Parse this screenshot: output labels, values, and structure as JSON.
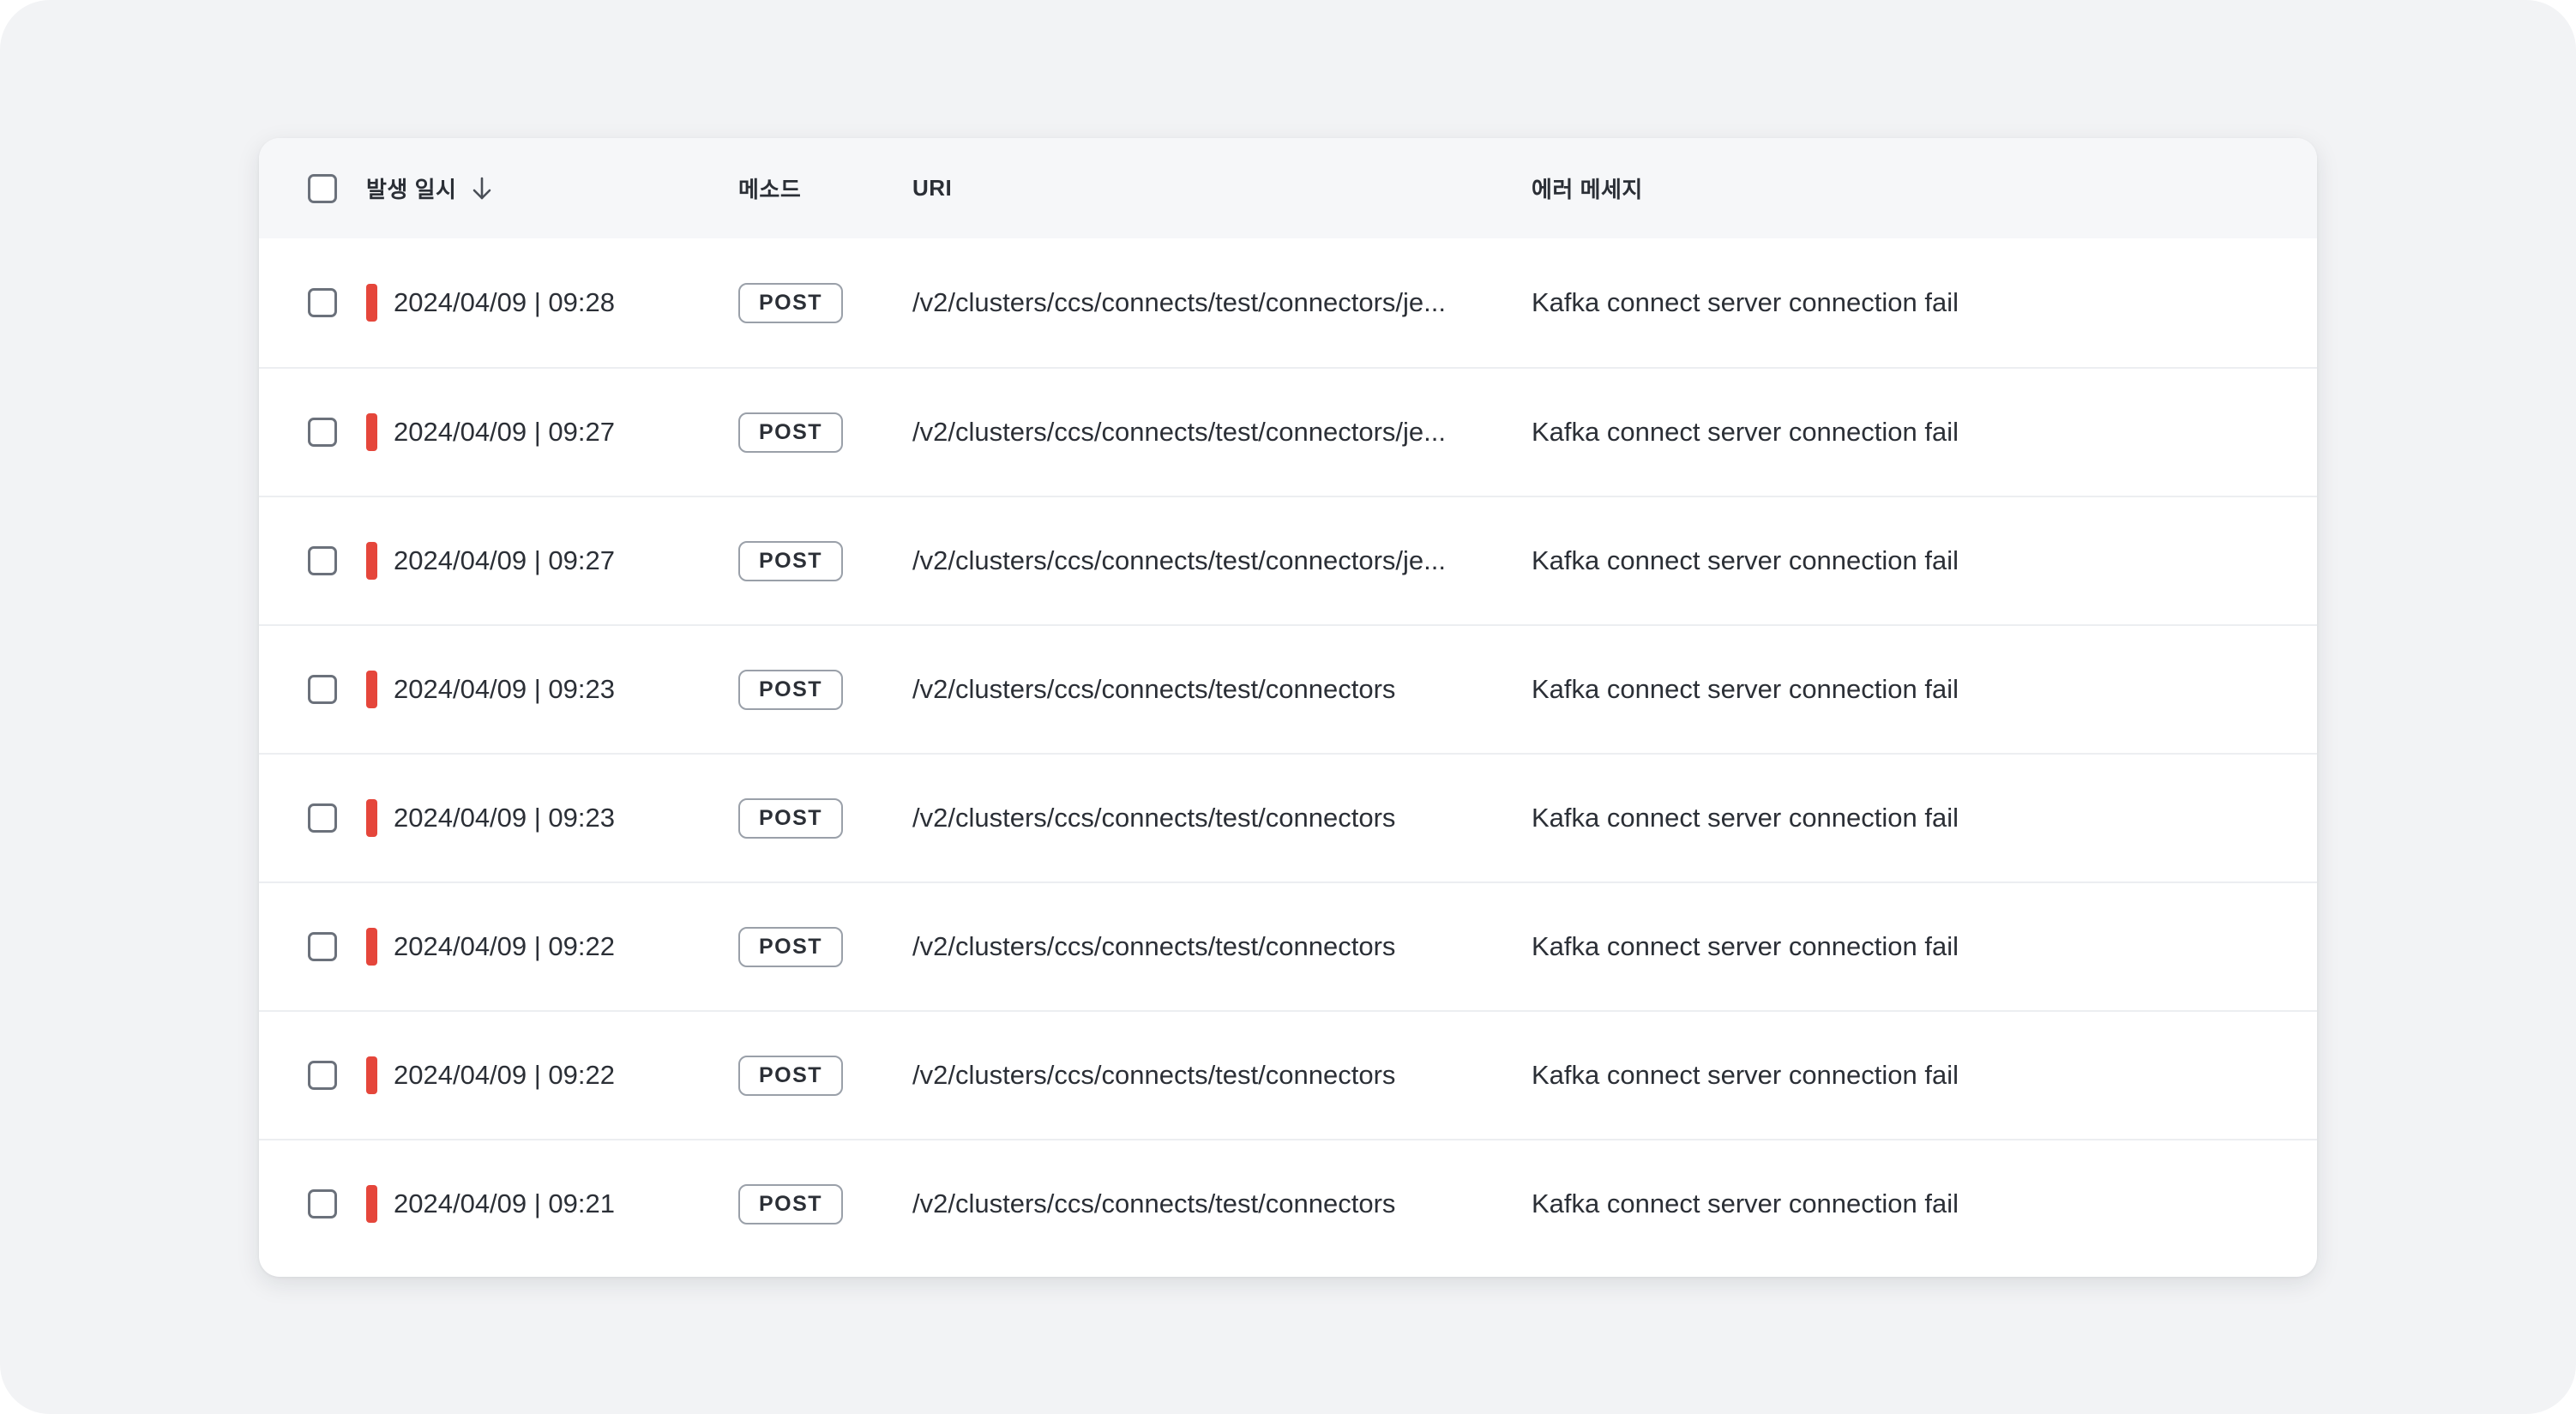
{
  "table": {
    "headers": {
      "date": "발생 일시",
      "method": "메소드",
      "uri": "URI",
      "message": "에러 메세지"
    },
    "sort": {
      "column": "date",
      "direction": "descending",
      "icon": "arrow-down-icon"
    },
    "level_color": "#e5463b",
    "rows": [
      {
        "date": "2024/04/09 | 09:28",
        "method": "POST",
        "uri": "/v2/clusters/ccs/connects/test/connectors/je...",
        "message": "Kafka connect server connection fail"
      },
      {
        "date": "2024/04/09 | 09:27",
        "method": "POST",
        "uri": "/v2/clusters/ccs/connects/test/connectors/je...",
        "message": "Kafka connect server connection fail"
      },
      {
        "date": "2024/04/09 | 09:27",
        "method": "POST",
        "uri": "/v2/clusters/ccs/connects/test/connectors/je...",
        "message": "Kafka connect server connection fail"
      },
      {
        "date": "2024/04/09 | 09:23",
        "method": "POST",
        "uri": "/v2/clusters/ccs/connects/test/connectors",
        "message": "Kafka connect server connection fail"
      },
      {
        "date": "2024/04/09 | 09:23",
        "method": "POST",
        "uri": "/v2/clusters/ccs/connects/test/connectors",
        "message": "Kafka connect server connection fail"
      },
      {
        "date": "2024/04/09 | 09:22",
        "method": "POST",
        "uri": "/v2/clusters/ccs/connects/test/connectors",
        "message": "Kafka connect server connection fail"
      },
      {
        "date": "2024/04/09 | 09:22",
        "method": "POST",
        "uri": "/v2/clusters/ccs/connects/test/connectors",
        "message": "Kafka connect server connection fail"
      },
      {
        "date": "2024/04/09 | 09:21",
        "method": "POST",
        "uri": "/v2/clusters/ccs/connects/test/connectors",
        "message": "Kafka connect server connection fail"
      }
    ]
  }
}
